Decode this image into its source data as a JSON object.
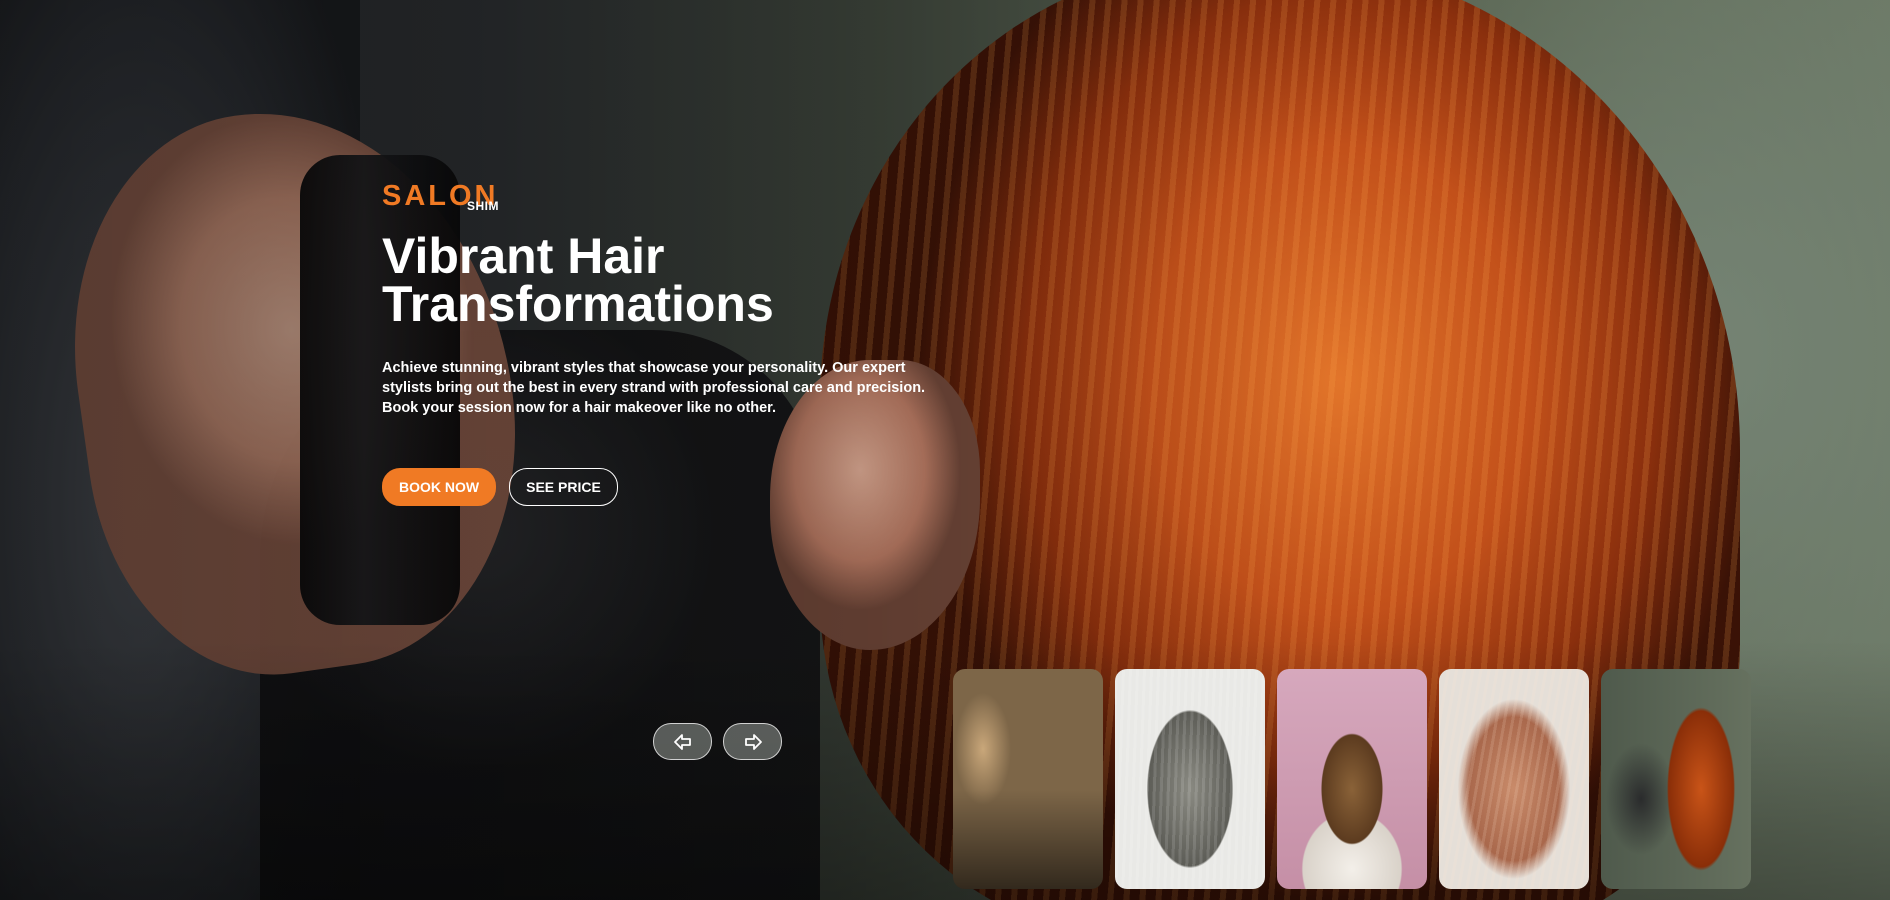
{
  "logo": {
    "main": "SALON",
    "sub": "SHIM"
  },
  "hero": {
    "title_line1": "Vibrant Hair",
    "title_line2": "Transformations",
    "description": "Achieve stunning, vibrant styles that showcase your personality. Our expert stylists bring out the best in every strand with professional care and precision. Book your session now for a hair makeover like no other.",
    "book_label": "BOOK NOW",
    "price_label": "SEE PRICE"
  },
  "slider": {
    "prev_icon": "arrow-left-icon",
    "next_icon": "arrow-right-icon",
    "thumbnails": 5
  },
  "colors": {
    "accent": "#f07a24",
    "text": "#ffffff"
  }
}
